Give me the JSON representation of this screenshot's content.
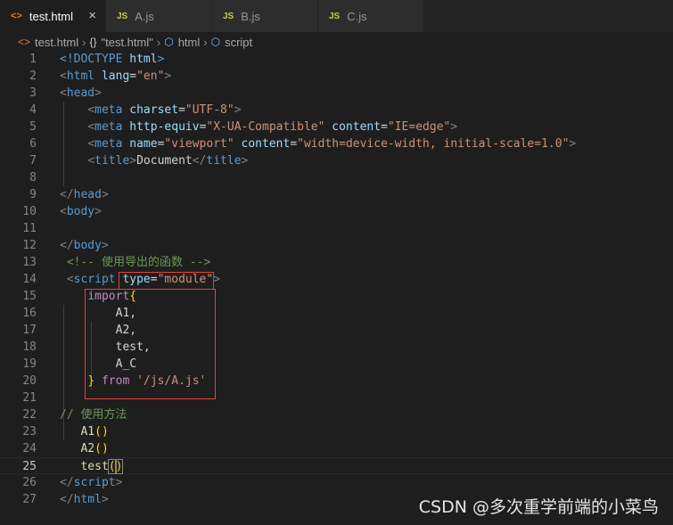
{
  "tabs": [
    {
      "label": "test.html",
      "icon": "html-file-icon",
      "active": true
    },
    {
      "label": "A.js",
      "icon": "js-file-icon",
      "active": false
    },
    {
      "label": "B.js",
      "icon": "js-file-icon",
      "active": false
    },
    {
      "label": "C.js",
      "icon": "js-file-icon",
      "active": false
    }
  ],
  "icons": {
    "html": "<>",
    "js": "JS",
    "brace": "{}",
    "cube": "⬡",
    "close": "×",
    "chevron": "›"
  },
  "breadcrumb": {
    "file": "test.html",
    "node": "\"test.html\"",
    "html": "html",
    "script": "script"
  },
  "line_numbers": [
    "1",
    "2",
    "3",
    "4",
    "5",
    "6",
    "7",
    "8",
    "9",
    "10",
    "11",
    "12",
    "13",
    "14",
    "15",
    "16",
    "17",
    "18",
    "19",
    "20",
    "21",
    "22",
    "23",
    "24",
    "25",
    "26",
    "27"
  ],
  "code": {
    "doctype": "<!DOCTYPE",
    "html_kw": "html",
    "gt": ">",
    "lt": "<",
    "lt_slash": "</",
    "eq": "=",
    "lang_attr": "lang",
    "lang_val": "\"en\"",
    "head": "head",
    "meta": "meta",
    "charset_attr": "charset",
    "charset_val": "\"UTF-8\"",
    "httpequiv_attr": "http-equiv",
    "httpequiv_val": "\"X-UA-Compatible\"",
    "content_attr": "content",
    "content_val1": "\"IE=edge\"",
    "name_attr": "name",
    "name_val": "\"viewport\"",
    "content_val2": "\"width=device-width, initial-scale=1.0\"",
    "title": "title",
    "title_text": "Document",
    "body": "body",
    "comment": "<!-- 使用导出的函数 -->",
    "script": "script",
    "type_attr": "type",
    "type_val": "\"module\"",
    "import": "import",
    "lbrace": "{",
    "rbrace": "}",
    "a1": "A1,",
    "a2": "A2,",
    "test_item": "test,",
    "a_c": "A_C",
    "from": "from",
    "path": "'/js/A.js'",
    "js_comment": "// 使用方法",
    "call_a1": "A1",
    "call_a2": "A2",
    "call_test": "test",
    "parens": "()",
    "lparen": "(",
    "rparen": ")"
  },
  "watermark": "CSDN @多次重学前端的小菜鸟",
  "colors": {
    "highlight_box": "#e8403a",
    "tag": "#569cd6",
    "attr": "#9cdcfe",
    "string": "#ce9178",
    "keyword": "#c586c0",
    "function": "#dcdcaa",
    "comment": "#6a9955"
  }
}
